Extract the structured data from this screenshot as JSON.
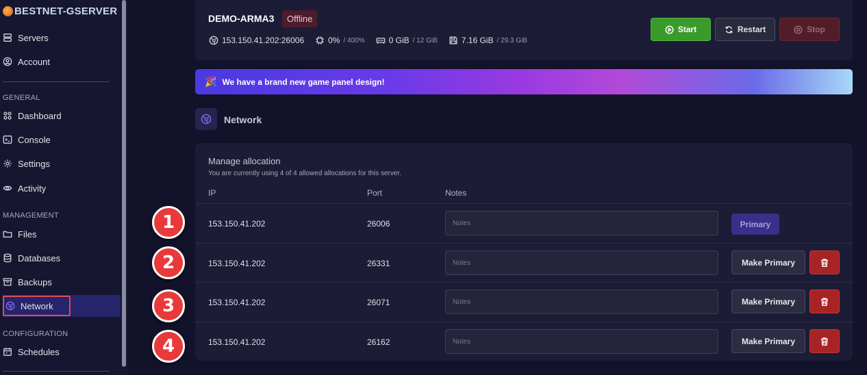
{
  "brand": {
    "name": "BESTNET-GSERVER"
  },
  "sidebar": {
    "top_items": [
      {
        "label": "Servers",
        "icon": "server-icon"
      },
      {
        "label": "Account",
        "icon": "account-icon"
      }
    ],
    "sections": {
      "general": "GENERAL",
      "management": "MANAGEMENT",
      "configuration": "CONFIGURATION"
    },
    "general_items": [
      {
        "label": "Dashboard",
        "icon": "dashboard-icon"
      },
      {
        "label": "Console",
        "icon": "console-icon"
      },
      {
        "label": "Settings",
        "icon": "gear-icon"
      },
      {
        "label": "Activity",
        "icon": "eye-icon"
      }
    ],
    "management_items": [
      {
        "label": "Files",
        "icon": "folder-icon"
      },
      {
        "label": "Databases",
        "icon": "database-icon"
      },
      {
        "label": "Backups",
        "icon": "archive-icon"
      },
      {
        "label": "Network",
        "icon": "network-icon",
        "active": true
      }
    ],
    "configuration_items": [
      {
        "label": "Schedules",
        "icon": "calendar-icon"
      }
    ]
  },
  "server": {
    "name": "DEMO-ARMA3",
    "status": "Offline",
    "address": "153.150.41.202:26006",
    "cpu": {
      "value": "0%",
      "limit": "/ 400%"
    },
    "memory": {
      "value": "0 GiB",
      "limit": "/ 12 GiB"
    },
    "disk": {
      "value": "7.16 GiB",
      "limit": "/ 29.3 GiB"
    },
    "buttons": {
      "start": "Start",
      "restart": "Restart",
      "stop": "Stop"
    }
  },
  "banner": {
    "text": "We have a brand new game panel design!"
  },
  "page": {
    "title": "Network"
  },
  "allocations": {
    "title": "Manage allocation",
    "subtitle": "You are currently using 4 of 4 allowed allocations for this server.",
    "columns": {
      "ip": "IP",
      "port": "Port",
      "notes": "Notes"
    },
    "notes_placeholder": "Notes",
    "primary_label": "Primary",
    "make_primary_label": "Make Primary",
    "rows": [
      {
        "ip": "153.150.41.202",
        "port": "26006",
        "primary": true
      },
      {
        "ip": "153.150.41.202",
        "port": "26331",
        "primary": false
      },
      {
        "ip": "153.150.41.202",
        "port": "26071",
        "primary": false
      },
      {
        "ip": "153.150.41.202",
        "port": "26162",
        "primary": false
      }
    ]
  },
  "annotations": [
    "1",
    "2",
    "3",
    "4"
  ],
  "colors": {
    "accent": "#3a9a2c",
    "danger": "#a82424",
    "highlight": "#e04a5a",
    "badge": "#e83a3a"
  }
}
